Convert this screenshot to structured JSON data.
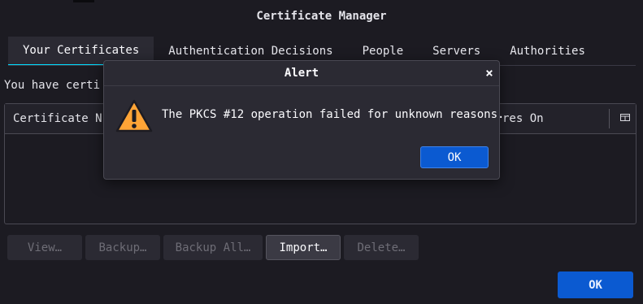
{
  "window": {
    "title": "Certificate Manager"
  },
  "tabs": [
    {
      "label": "Your Certificates",
      "selected": true
    },
    {
      "label": "Authentication Decisions",
      "selected": false
    },
    {
      "label": "People",
      "selected": false
    },
    {
      "label": "Servers",
      "selected": false
    },
    {
      "label": "Authorities",
      "selected": false
    }
  ],
  "info_text": "You have certi",
  "tree": {
    "columns": [
      {
        "label": "Certificate N"
      },
      {
        "label": "res On"
      }
    ],
    "column_picker_icon": "column-picker-icon"
  },
  "buttons": [
    {
      "label": "View…",
      "enabled": false
    },
    {
      "label": "Backup…",
      "enabled": false
    },
    {
      "label": "Backup All…",
      "enabled": false
    },
    {
      "label": "Import…",
      "enabled": true
    },
    {
      "label": "Delete…",
      "enabled": false
    }
  ],
  "main_ok_label": "OK",
  "alert": {
    "title": "Alert",
    "close_icon": "close-icon",
    "icon": "warning-icon",
    "message": "The PKCS #12 operation failed for unknown reasons.",
    "ok_label": "OK"
  },
  "colors": {
    "accent": "#0b5ad1",
    "tab_indicator": "#00ddff",
    "warning": "#ffa436",
    "background": "#1c1b22",
    "dialog_background": "#2b2a33"
  }
}
